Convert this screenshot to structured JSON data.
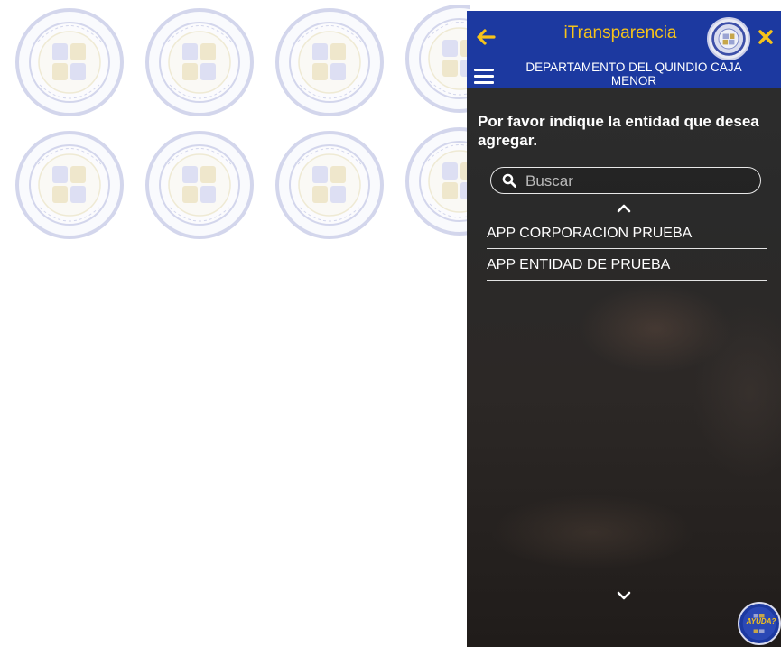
{
  "watermark": {
    "icon": "pct-seal-icon",
    "ring_text_top": "CALIDAD",
    "ring_text_bottom": "PCT LIDA",
    "color": "#8d96cf"
  },
  "header": {
    "title": "iTransparencia",
    "entity_name": "DEPARTAMENTO DEL QUINDIO CAJA MENOR",
    "back_icon": "arrow-left-icon",
    "close_icon": "close-icon",
    "menu_icon": "hamburger-menu-icon",
    "accent_color": "#f6c31a",
    "bar_color": "#1c39a0"
  },
  "main": {
    "prompt": "Por favor indique la entidad que desea agregar.",
    "search": {
      "placeholder": "Buscar",
      "value": ""
    },
    "entities": [
      {
        "label": "APP CORPORACION PRUEBA"
      },
      {
        "label": "APP ENTIDAD DE PRUEBA"
      }
    ]
  },
  "help": {
    "label": "AYUDA?"
  }
}
